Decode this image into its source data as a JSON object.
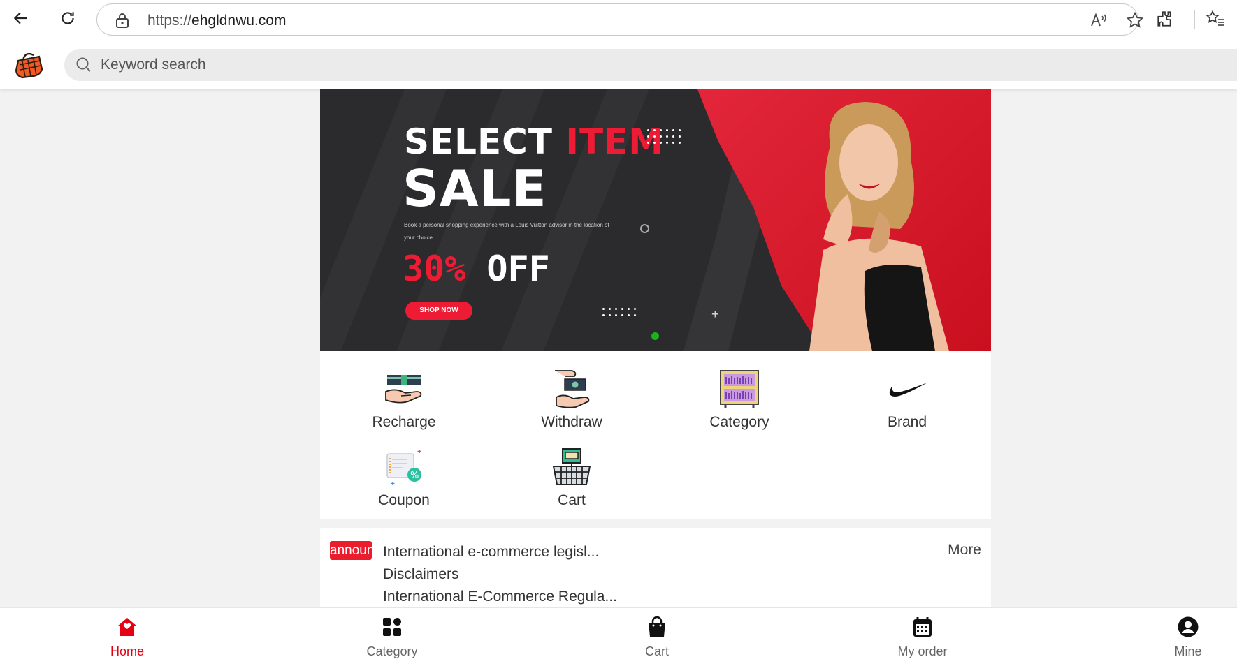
{
  "browser": {
    "url_scheme": "https://",
    "url_host": "ehgldnwu.com",
    "icons": [
      "back-arrow-icon",
      "refresh-icon",
      "lock-icon",
      "read-aloud-icon",
      "favorite-star-icon",
      "extensions-icon",
      "favorites-icon"
    ]
  },
  "header": {
    "search_placeholder": "Keyword search"
  },
  "banner": {
    "title_white": "SELECT ",
    "title_red": "ITEM",
    "title_main": "SALE",
    "description": "Book a personal shopping experience with a Louis Vuitton advisor in the location of your choice",
    "discount_red": "30%",
    "discount_white": " OFF",
    "button": "SHOP NOW",
    "slide_indicator_color": "#1bb31b"
  },
  "quick_menu": {
    "items": [
      {
        "label": "Recharge",
        "icon": "recharge-icon"
      },
      {
        "label": "Withdraw",
        "icon": "withdraw-icon"
      },
      {
        "label": "Category",
        "icon": "category-shelf-icon"
      },
      {
        "label": "Brand",
        "icon": "nike-swoosh-icon"
      },
      {
        "label": "Coupon",
        "icon": "coupon-icon"
      },
      {
        "label": "Cart",
        "icon": "basket-cart-icon"
      }
    ]
  },
  "announcement": {
    "tag": "announcement",
    "items": [
      "International e-commerce legisl...",
      "Disclaimers",
      "International E-Commerce Regula..."
    ],
    "more": "More"
  },
  "bottom_nav": {
    "items": [
      {
        "label": "Home",
        "icon": "home-icon",
        "active": true
      },
      {
        "label": "Category",
        "icon": "grid-icon",
        "active": false
      },
      {
        "label": "Cart",
        "icon": "shopping-bag-icon",
        "active": false
      },
      {
        "label": "My order",
        "icon": "calendar-icon",
        "active": false
      },
      {
        "label": "Mine",
        "icon": "user-icon",
        "active": false
      }
    ],
    "active_color": "#e60012"
  }
}
